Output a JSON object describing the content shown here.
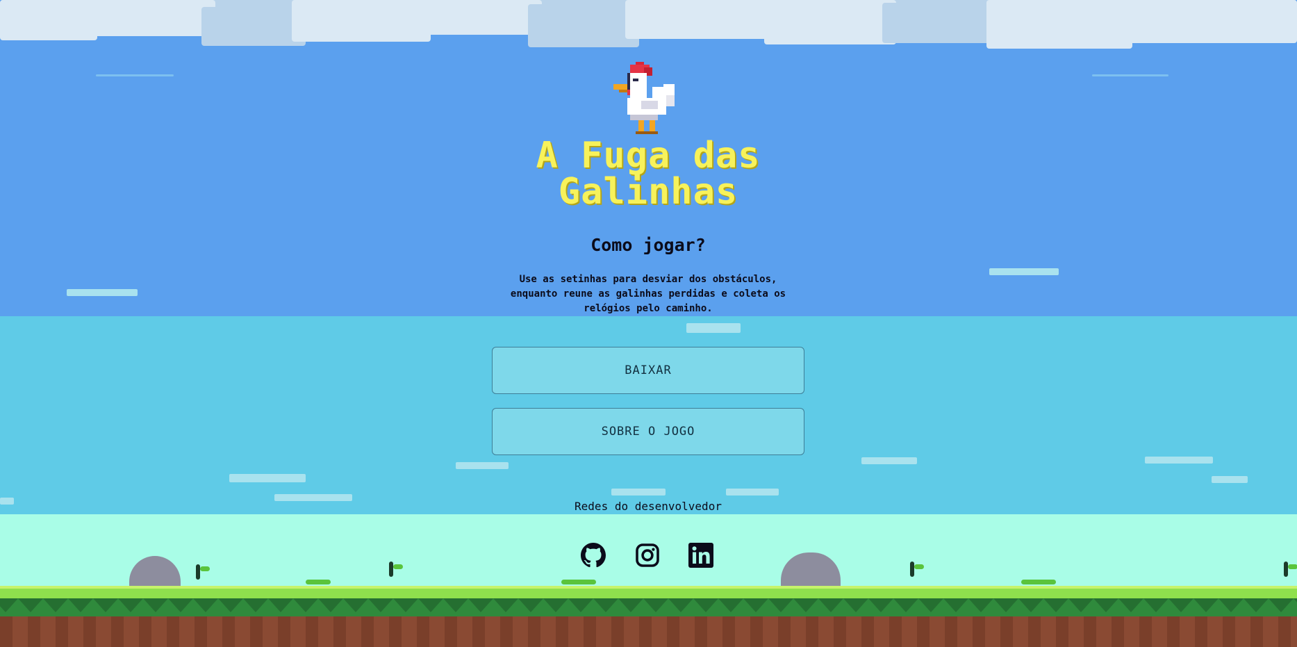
{
  "game": {
    "title": "A Fuga das Galinhas",
    "title_line1": "A Fuga das",
    "title_line2": "Galinhas"
  },
  "how_to_play": {
    "heading": "Como jogar?",
    "description": "Use as setinhas para desviar dos obstáculos, enquanto reune as galinhas perdidas e coleta os relógios pelo caminho."
  },
  "buttons": {
    "download_label": "BAIXAR",
    "about_label": "SOBRE O JOGO"
  },
  "social": {
    "label": "Redes do desenvolvedor",
    "links": [
      {
        "icon": "github-icon"
      },
      {
        "icon": "instagram-icon"
      },
      {
        "icon": "linkedin-icon"
      }
    ]
  },
  "colors": {
    "sky_top": "#5ba0ee",
    "sky_mid": "#5fcbe7",
    "sky_low": "#a9fde7",
    "title": "#f7f25b",
    "button_bg": "#7ed8ea",
    "button_border": "#3d7e97",
    "grass": "#8fe04d",
    "dirt": "#8a4a33"
  }
}
